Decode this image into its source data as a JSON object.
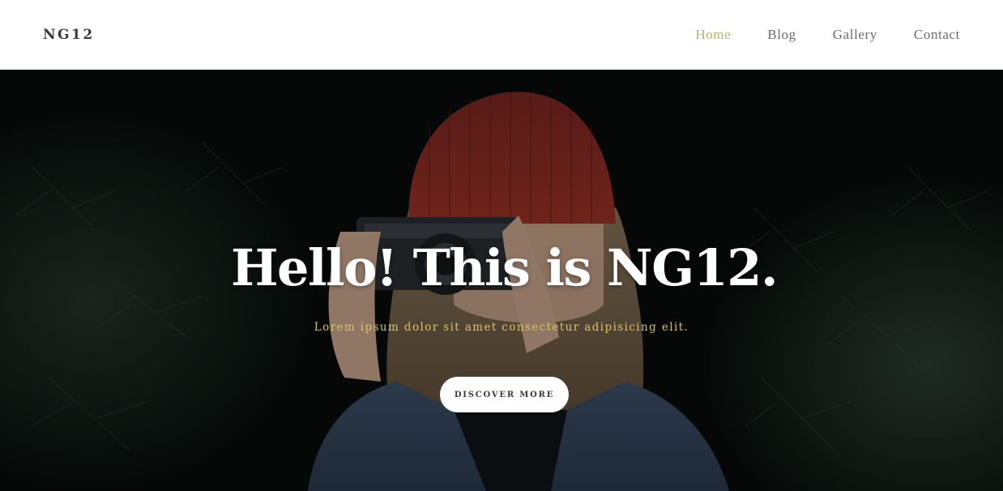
{
  "header": {
    "logo": "NG12",
    "nav": [
      {
        "label": "Home",
        "active": true
      },
      {
        "label": "Blog",
        "active": false
      },
      {
        "label": "Gallery",
        "active": false
      },
      {
        "label": "Contact",
        "active": false
      }
    ]
  },
  "hero": {
    "title": "Hello! This is NG12.",
    "subtitle": "Lorem ipsum dolor sit amet consectetur adipisicing elit.",
    "cta_label": "DISCOVER MORE",
    "image": "woman-with-red-beanie-holding-camera-photo"
  },
  "colors": {
    "accent_active_nav": "#bdb06e",
    "subtitle_text": "#d9c45a",
    "nav_text": "#6b6b6b",
    "logo_text": "#3a3a3a",
    "hero_background": "#0b1411"
  }
}
